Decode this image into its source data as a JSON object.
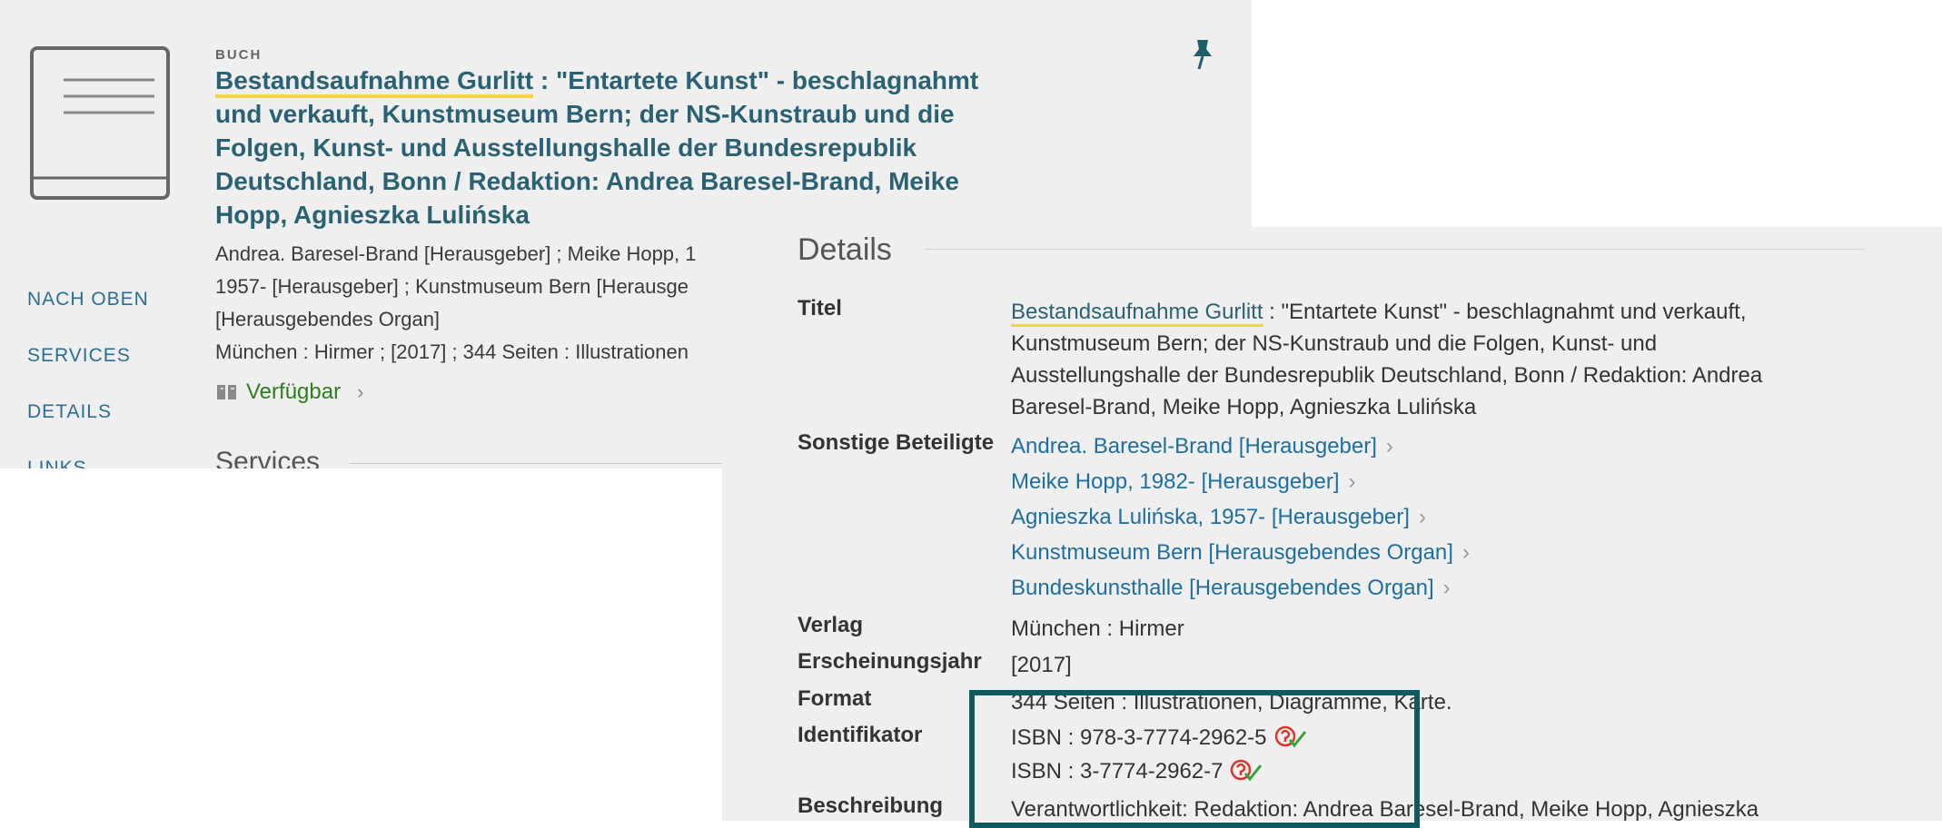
{
  "record": {
    "type": "BUCH",
    "title_link": "Bestandsaufnahme Gurlitt",
    "title_rest": " : \"Entartete Kunst\" - beschlagnahmt und verkauft, Kunstmuseum Bern; der NS-Kunstraub und die Folgen, Kunst- und Ausstellungshalle der Bundesrepublik Deutschland, Bonn / Redaktion: Andrea Baresel-Brand, Meike Hopp, Agnieszka Lulińska",
    "meta_lines": [
      "Andrea. Baresel-Brand [Herausgeber] ; Meike Hopp, 1",
      "1957- [Herausgeber] ; Kunstmuseum Bern [Herausge",
      "[Herausgebendes Organ]",
      "München : Hirmer ; [2017] ; 344 Seiten : Illustrationen"
    ],
    "availability": "Verfügbar",
    "availability_icon": "book-availability-icon",
    "pin_icon": "pin-icon"
  },
  "side_nav": {
    "items": [
      "NACH OBEN",
      "SERVICES",
      "DETAILS",
      "LINKS"
    ]
  },
  "services": {
    "heading": "Services"
  },
  "details": {
    "heading": "Details",
    "title_label": "Titel",
    "title_link": "Bestandsaufnahme Gurlitt",
    "title_lines": [
      " : \"Entartete Kunst\" - beschlagnahmt und verkauft,",
      "Kunstmuseum Bern; der NS-Kunstraub und die Folgen, Kunst- und",
      "Ausstellungshalle der Bundesrepublik Deutschland, Bonn / Redaktion: Andrea",
      "Baresel-Brand, Meike Hopp, Agnieszka Lulińska"
    ],
    "contributors_label": "Sonstige Beteiligte",
    "contributors": [
      "Andrea. Baresel-Brand [Herausgeber]",
      "Meike Hopp, 1982- [Herausgeber]",
      "Agnieszka Lulińska, 1957- [Herausgeber]",
      "Kunstmuseum Bern [Herausgebendes Organ]",
      "Bundeskunsthalle [Herausgebendes Organ]"
    ],
    "publisher_label": "Verlag",
    "publisher": "München : Hirmer",
    "year_label": "Erscheinungsjahr",
    "year": "[2017]",
    "format_label": "Format",
    "format": "344 Seiten : Illustrationen, Diagramme, Karte.",
    "identifier_label": "Identifikator",
    "isbns": [
      "ISBN : 978-3-7774-2962-5",
      "ISBN : 3-7774-2962-7"
    ],
    "description_label": "Beschreibung",
    "description": "Verantwortlichkeit: Redaktion: Andrea Baresel-Brand, Meike Hopp, Agnieszka"
  },
  "colors": {
    "link": "#1e6f9f",
    "title": "#2a6273",
    "available": "#2e7d1f",
    "highlight_underline": "#f1d44c",
    "focus_box": "#0f5a5f"
  }
}
